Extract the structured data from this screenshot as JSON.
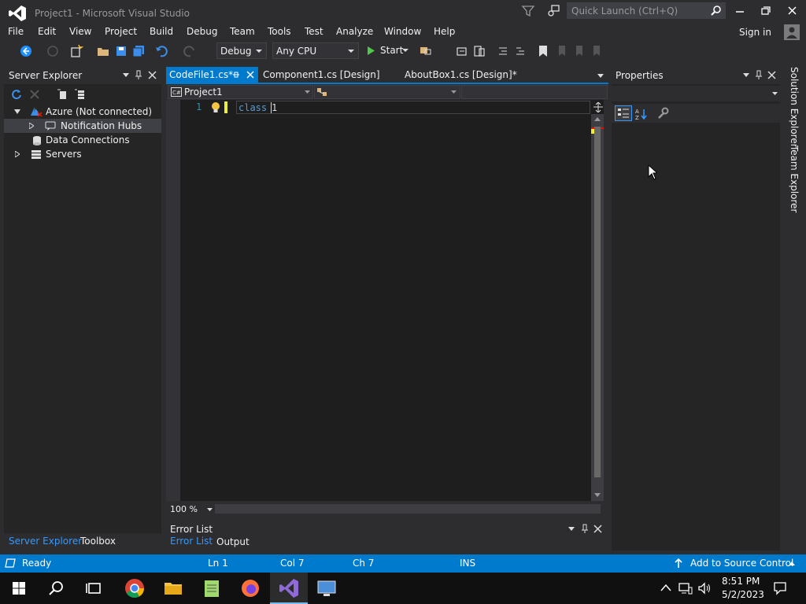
{
  "window": {
    "title": "Project1 - Microsoft Visual Studio",
    "quick_launch_placeholder": "Quick Launch (Ctrl+Q)"
  },
  "menu": {
    "items": [
      "File",
      "Edit",
      "View",
      "Project",
      "Build",
      "Debug",
      "Team",
      "Tools",
      "Test",
      "Analyze",
      "Window",
      "Help"
    ],
    "sign_in": "Sign in"
  },
  "toolbar": {
    "configuration": "Debug",
    "platform": "Any CPU",
    "start_label": "Start"
  },
  "server_explorer": {
    "title": "Server Explorer",
    "tree": [
      {
        "label": "Azure (Not connected)",
        "icon": "azure-icon"
      },
      {
        "label": "Notification Hubs",
        "icon": "notification-hubs-icon"
      },
      {
        "label": "Data Connections",
        "icon": "data-connections-icon"
      },
      {
        "label": "Servers",
        "icon": "servers-icon"
      }
    ],
    "tabs": [
      "Server Explorer",
      "Toolbox"
    ]
  },
  "editor": {
    "tabs": [
      "CodeFile1.cs*",
      "Component1.cs [Design]",
      "AboutBox1.cs [Design]*"
    ],
    "nav_project": "Project1",
    "line_number": "1",
    "code_keyword": "class",
    "code_identifier": "1",
    "zoom": "100 %"
  },
  "error_list": {
    "title": "Error List",
    "tabs": [
      "Error List",
      "Output"
    ]
  },
  "properties": {
    "title": "Properties"
  },
  "side_tabs": [
    "Solution Explorer",
    "Team Explorer"
  ],
  "status_bar": {
    "state": "Ready",
    "line": "Ln 1",
    "col": "Col 7",
    "ch": "Ch 7",
    "mode": "INS",
    "source_control": "Add to Source Control"
  },
  "taskbar": {
    "time": "8:51 PM",
    "date": "5/2/2023"
  },
  "colors": {
    "accent": "#007acc",
    "background": "#2d2d30",
    "editor_bg": "#1e1e1e",
    "keyword": "#569cd6"
  }
}
